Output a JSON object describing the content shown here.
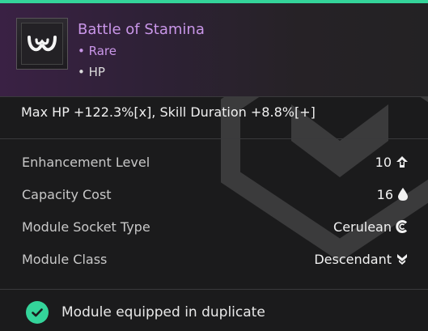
{
  "module": {
    "name": "Battle of Stamina",
    "rarity": "• Rare",
    "type": "• HP",
    "effect": "Max HP +122.3%[x], Skill Duration +8.8%[+]"
  },
  "stats": [
    {
      "label": "Enhancement Level",
      "value": "10",
      "icon": "enhancement-arrow-icon"
    },
    {
      "label": "Capacity Cost",
      "value": "16",
      "icon": "droplet-icon"
    },
    {
      "label": "Module Socket Type",
      "value": "Cerulean",
      "icon": "cerulean-socket-icon"
    },
    {
      "label": "Module Class",
      "value": "Descendant",
      "icon": "descendant-class-icon"
    }
  ],
  "footer": {
    "status": "Module equipped in duplicate",
    "icon": "check-circle-icon"
  },
  "colors": {
    "accent": "#34d49a",
    "rarity": "#c996e8"
  }
}
